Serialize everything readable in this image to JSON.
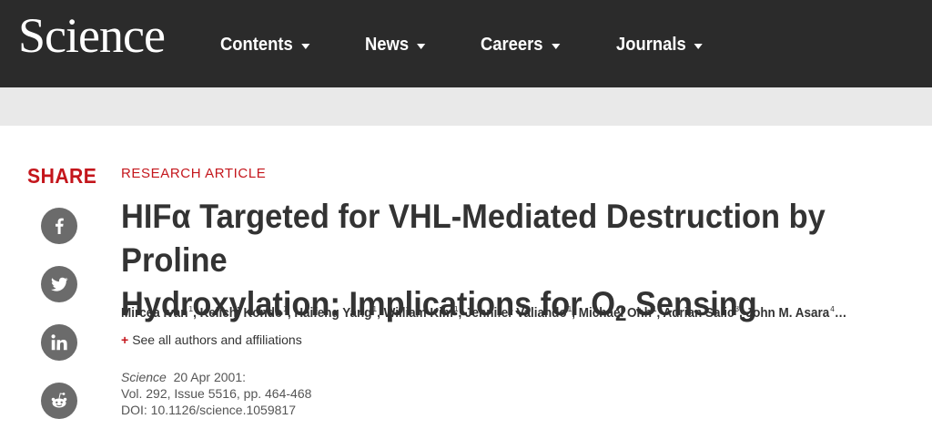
{
  "header": {
    "logo": "Science",
    "nav": [
      {
        "label": "Contents"
      },
      {
        "label": "News"
      },
      {
        "label": "Careers"
      },
      {
        "label": "Journals"
      }
    ]
  },
  "share": {
    "label": "SHARE",
    "buttons": [
      {
        "icon": "facebook-icon"
      },
      {
        "icon": "twitter-icon"
      },
      {
        "icon": "linkedin-icon"
      },
      {
        "icon": "reddit-icon"
      }
    ]
  },
  "article": {
    "kicker": "RESEARCH ARTICLE",
    "title_line1": "HIFα Targeted for VHL-Mediated Destruction by Proline",
    "title_line2_pre": "Hydroxylation: Implications for O",
    "title_line2_sub": "2",
    "title_line2_post": " Sensing",
    "authors": [
      {
        "name": "Mircea Ivan",
        "aff": "1"
      },
      {
        "name": "Keiichi Kondo",
        "aff": "1"
      },
      {
        "name": "Haifeng Yang",
        "aff": "1"
      },
      {
        "name": "William Kim",
        "aff": "1"
      },
      {
        "name": "Jennifer Valiando",
        "aff": "1"
      },
      {
        "name": "Michael Ohh",
        "aff": "1"
      },
      {
        "name": "Adrian Salic",
        "aff": "3"
      },
      {
        "name": "John M. Asara",
        "aff": "4"
      }
    ],
    "authors_ellipsis": "…",
    "see_all_plus": "+",
    "see_all": "See all authors and affiliations",
    "journal": "Science",
    "date": "20 Apr 2001:",
    "volume": "Vol. 292, Issue 5516, pp. 464-468",
    "doi": "DOI: 10.1126/science.1059817"
  },
  "colors": {
    "header_bg": "#2b2b2b",
    "subbar_bg": "#e9e9e9",
    "accent_red": "#c4161c",
    "share_icon_bg": "#6b6b6b"
  }
}
